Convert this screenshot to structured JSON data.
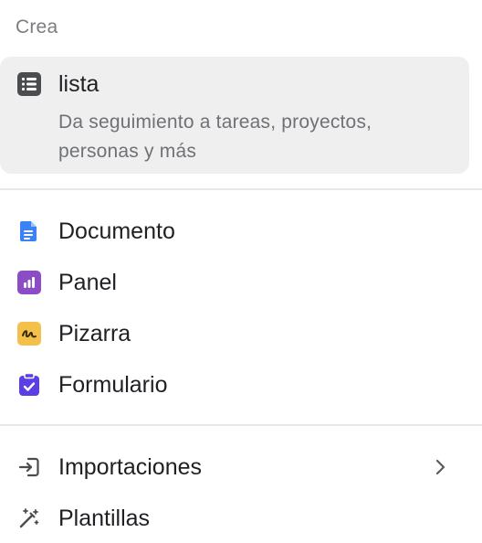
{
  "menu": {
    "section_title": "Crea",
    "featured": {
      "icon": "list-icon",
      "label": "lista",
      "description": "Da seguimiento a tareas, proyectos, personas y más"
    },
    "items": [
      {
        "icon": "document-icon",
        "label": "Documento",
        "color": "#3b82f6"
      },
      {
        "icon": "panel-chart-icon",
        "label": "Panel",
        "color": "#8b4cc6"
      },
      {
        "icon": "whiteboard-icon",
        "label": "Pizarra",
        "color": "#f3c04b"
      },
      {
        "icon": "form-clipboard-icon",
        "label": "Formulario",
        "color": "#5b3ee6"
      }
    ],
    "secondary": [
      {
        "icon": "import-icon",
        "label": "Importaciones",
        "has_submenu": true
      },
      {
        "icon": "magic-wand-icon",
        "label": "Plantillas",
        "has_submenu": false
      }
    ]
  }
}
